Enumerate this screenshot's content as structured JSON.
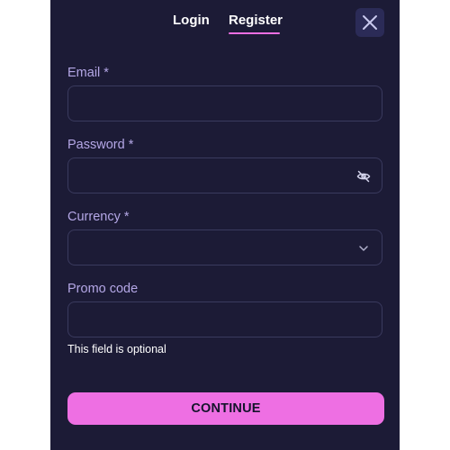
{
  "tabs": {
    "login_label": "Login",
    "register_label": "Register",
    "active": "Register"
  },
  "close_icon": "close-icon",
  "form": {
    "email": {
      "label": "Email *",
      "value": "",
      "placeholder": ""
    },
    "password": {
      "label": "Password *",
      "value": "",
      "placeholder": "",
      "icon": "eye-off-icon"
    },
    "currency": {
      "label": "Currency *",
      "selected": "",
      "icon": "chevron-down-icon"
    },
    "promo": {
      "label": "Promo code",
      "value": "",
      "placeholder": "",
      "hint": "This field is optional"
    }
  },
  "continue_label": "CONTINUE",
  "colors": {
    "panel_bg": "#1c1b36",
    "accent": "#ee6fe3",
    "label": "#b4a7e6",
    "field_border": "#3a3a5e",
    "close_bg": "#2b2b57"
  }
}
